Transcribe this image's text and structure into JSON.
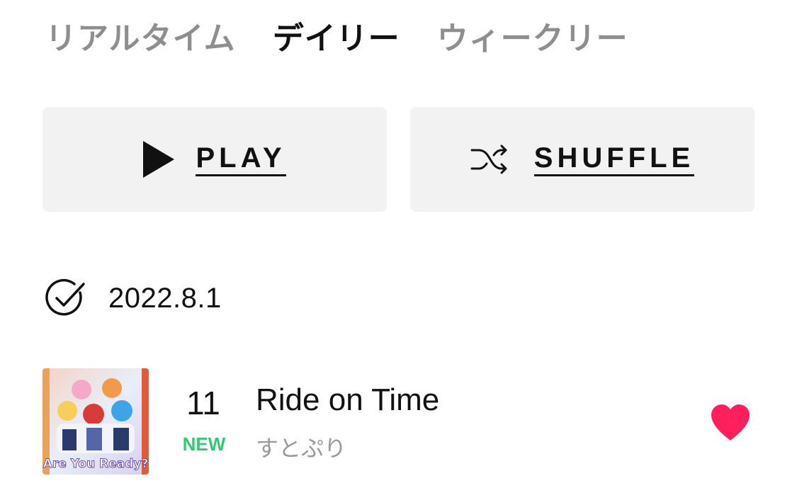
{
  "tabs": [
    {
      "label": "リアルタイム",
      "active": false
    },
    {
      "label": "デイリー",
      "active": true
    },
    {
      "label": "ウィークリー",
      "active": false
    }
  ],
  "actions": {
    "play_label": "PLAY",
    "shuffle_label": "SHUFFLE"
  },
  "chart": {
    "date": "2022.8.1"
  },
  "tracks": [
    {
      "rank": "11",
      "badge": "NEW",
      "title": "Ride on Time",
      "artist": "すとぷり",
      "cover_text": "Are You Ready?",
      "liked": true
    }
  ],
  "colors": {
    "active_tab": "#111111",
    "inactive_tab": "#8e8e8e",
    "button_bg": "#f2f2f2",
    "new_badge": "#2ecc71",
    "heart": "#ff1f5a",
    "artist": "#9a9a9a"
  }
}
